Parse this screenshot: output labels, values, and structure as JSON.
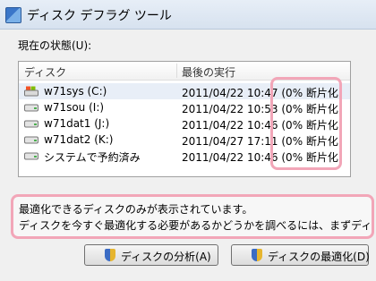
{
  "window": {
    "title": "ディスク デフラグ ツール"
  },
  "status_label": "現在の状態(U):",
  "list": {
    "headers": [
      "ディスク",
      "最後の実行"
    ],
    "rows": [
      {
        "icon": "drive-icon",
        "name": "w71sys (C:)",
        "last": "2011/04/22 10:47 (0% 断片化)"
      },
      {
        "icon": "drive-icon",
        "name": "w71sou (I:)",
        "last": "2011/04/22 10:53 (0% 断片化)"
      },
      {
        "icon": "drive-icon",
        "name": "w71dat1 (J:)",
        "last": "2011/04/22 10:46 (0% 断片化)"
      },
      {
        "icon": "drive-icon",
        "name": "w71dat2 (K:)",
        "last": "2011/04/27 17:11 (0% 断片化)"
      },
      {
        "icon": "drive-icon",
        "name": "システムで予約済み",
        "last": "2011/04/22 10:46 (0% 断片化)"
      }
    ]
  },
  "info": {
    "line1": "最適化できるディスクのみが表示されています。",
    "line2": "ディスクを今すぐ最適化する必要があるかどうかを調べるには、まずディスクを分析する必要"
  },
  "buttons": {
    "analyze": "ディスクの分析(A)",
    "defrag": "ディスクの最適化(D)"
  },
  "colors": {
    "highlight": "#f2a6b8",
    "selected_row": "#e8eef7"
  }
}
